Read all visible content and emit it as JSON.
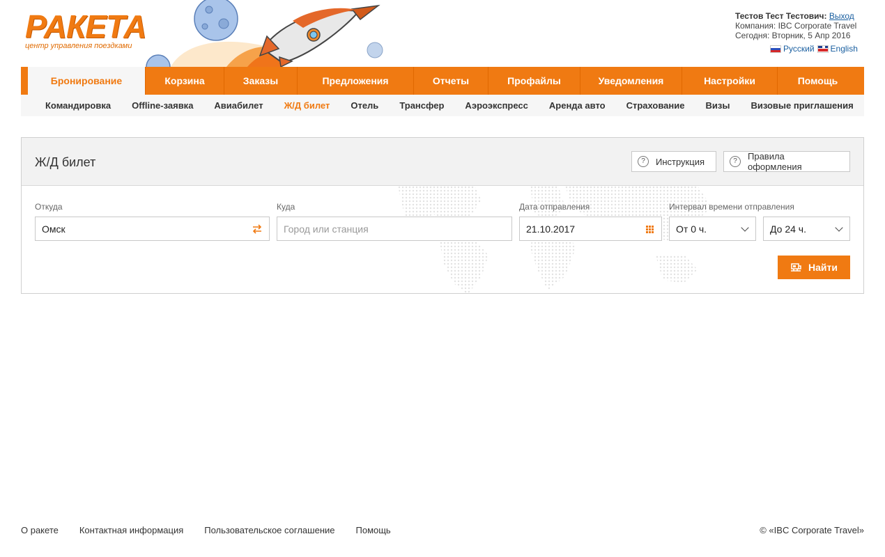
{
  "logo": {
    "title": "РАКЕТА",
    "subtitle": "центр управления поездками"
  },
  "user": {
    "name": "Тестов Тест Тестович:",
    "logout": "Выход",
    "company": "Компания: IBC Corporate Travel",
    "today": "Сегодня: Вторник, 5 Апр 2016"
  },
  "languages": [
    "Русский",
    "English"
  ],
  "nav": {
    "items": [
      "Бронирование",
      "Корзина",
      "Заказы",
      "Предложения",
      "Отчеты",
      "Профайлы",
      "Уведомления",
      "Настройки",
      "Помощь"
    ],
    "active": "Бронирование"
  },
  "subnav": {
    "items": [
      "Командировка",
      "Offline-заявка",
      "Авиабилет",
      "Ж/Д билет",
      "Отель",
      "Трансфер",
      "Аэроэкспресс",
      "Аренда авто",
      "Страхование",
      "Визы",
      "Визовые приглашения"
    ],
    "active": "Ж/Д билет"
  },
  "panel": {
    "title": "Ж/Д билет",
    "instruction_button": "Инструкция",
    "rules_button": "Правила оформления"
  },
  "form": {
    "from_label": "Откуда",
    "from_value": "Омск",
    "to_label": "Куда",
    "to_placeholder": "Город или станция",
    "date_label": "Дата отправления",
    "date_value": "21.10.2017",
    "interval_label": "Интервал времени отправления",
    "time_from": "От 0 ч.",
    "time_to": "До 24 ч.",
    "search_button": "Найти"
  },
  "footer": {
    "links": [
      "О ракете",
      "Контактная информация",
      "Пользовательское соглашение",
      "Помощь"
    ],
    "copyright": "© «IBC Corporate Travel»"
  },
  "colors": {
    "accent": "#f07a12",
    "link": "#1a5fa0",
    "panel_head": "#f2f2f2"
  }
}
